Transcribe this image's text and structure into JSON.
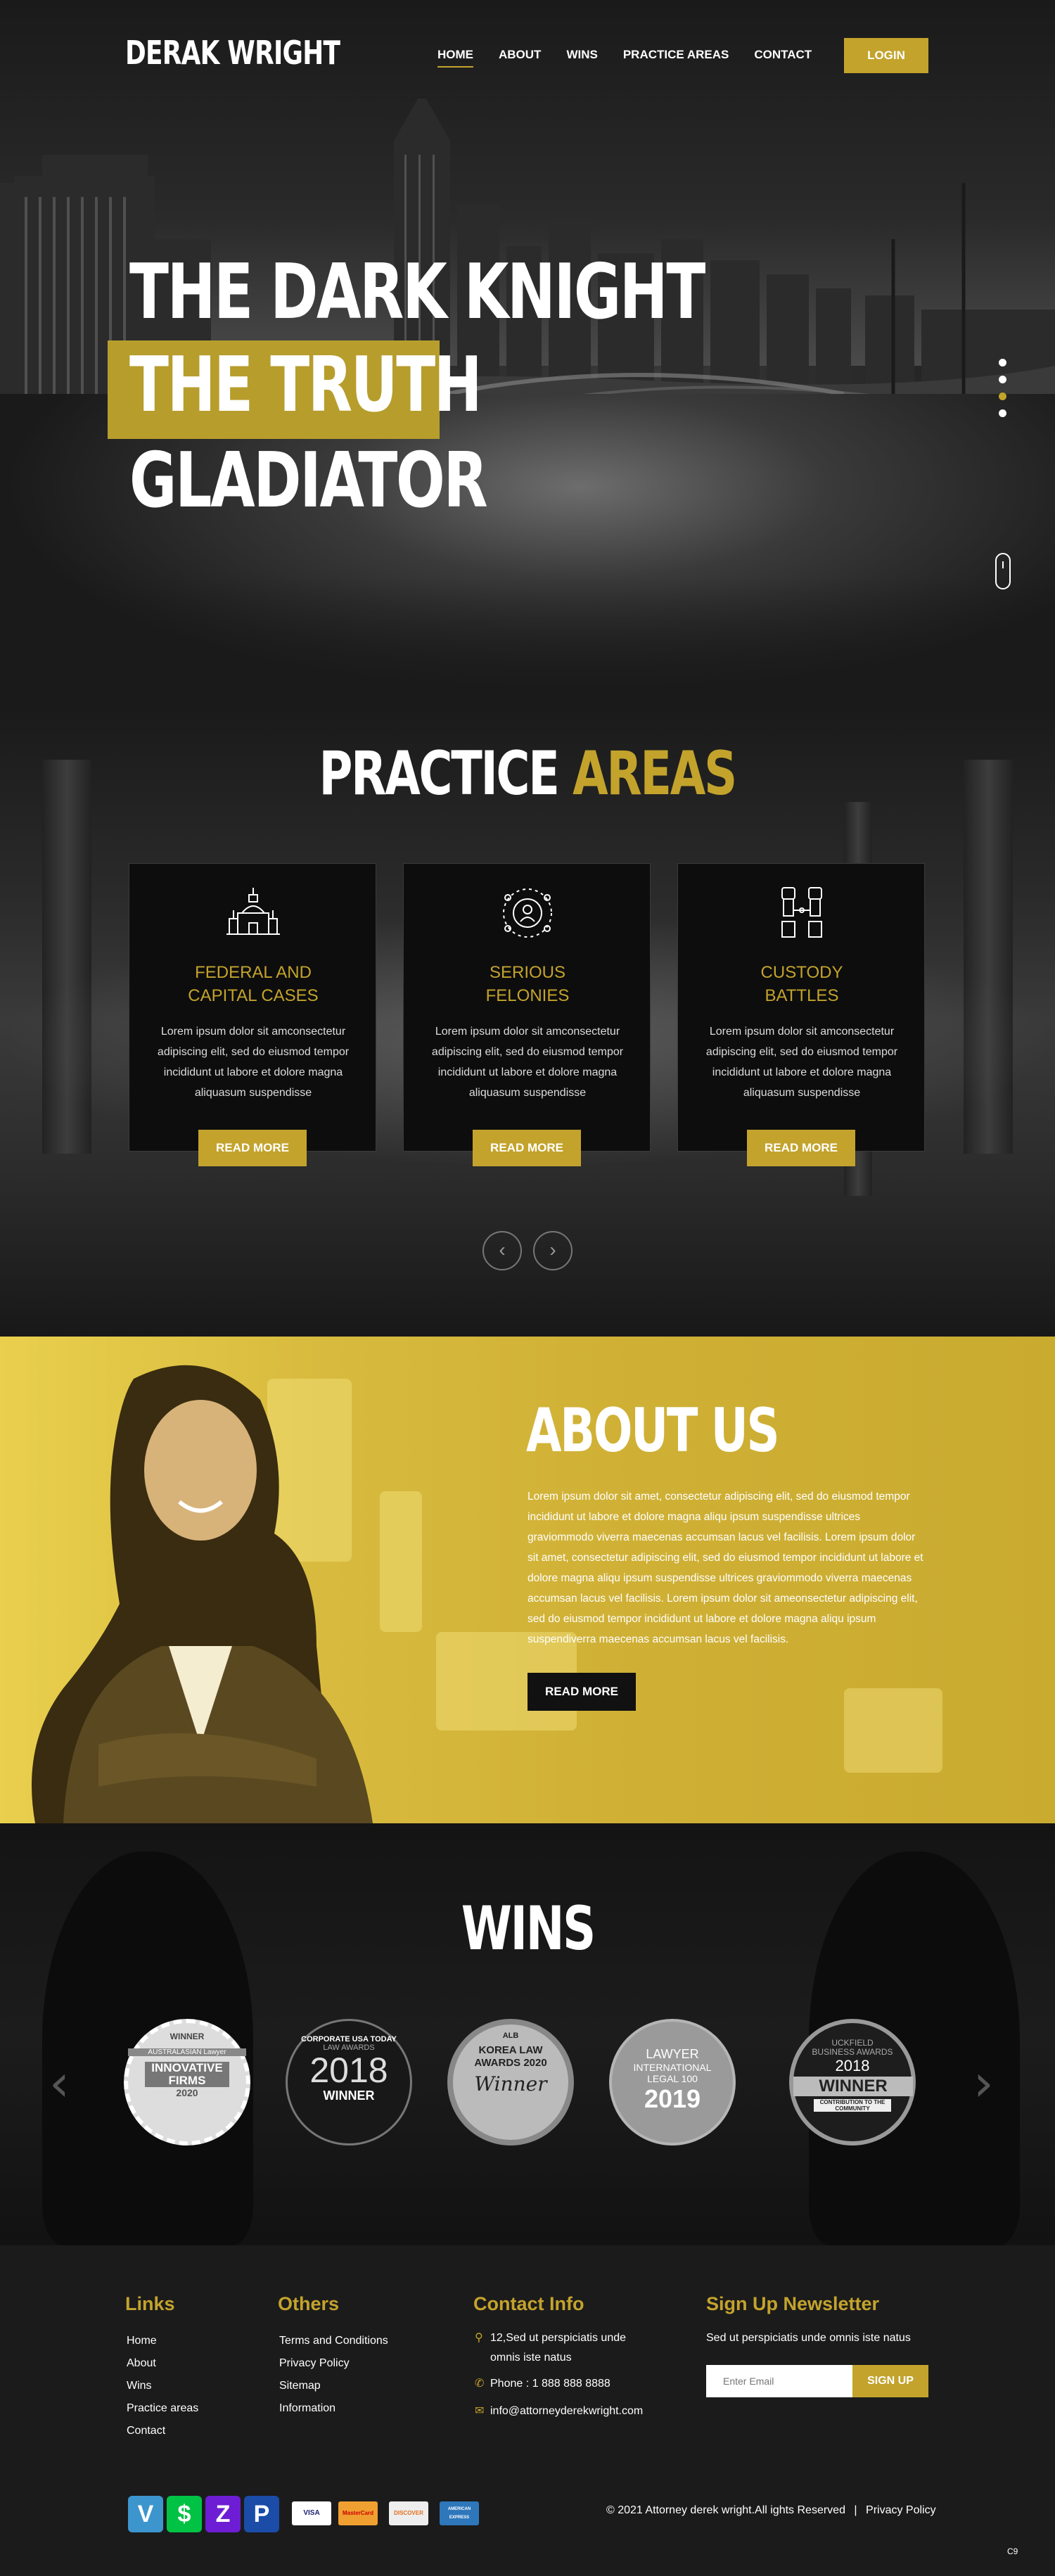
{
  "brand": {
    "name": "DERAK WRIGHT"
  },
  "nav": {
    "items": [
      {
        "label": "HOME",
        "active": true
      },
      {
        "label": "ABOUT",
        "active": false
      },
      {
        "label": "WINS",
        "active": false
      },
      {
        "label": "PRACTICE AREAS",
        "active": false
      },
      {
        "label": "CONTACT",
        "active": false
      }
    ],
    "login_label": "LOGIN"
  },
  "hero": {
    "line1": "THE DARK KNIGHT",
    "line2": "THE TRUTH",
    "line3": "GLADIATOR",
    "slides": 4,
    "active_slide": 3
  },
  "practice": {
    "title_white": "PRACTICE",
    "title_gold": "AREAS",
    "cards": [
      {
        "title_line1": "FEDERAL AND",
        "title_line2": "CAPITAL CASES",
        "icon": "building-icon",
        "text": "Lorem ipsum dolor sit amconsectetur adipiscing elit, sed do eiusmod tempor incididunt ut labore et dolore magna aliquasum suspendisse",
        "button": "READ MORE"
      },
      {
        "title_line1": "SERIOUS",
        "title_line2": "FELONIES",
        "icon": "person-network-icon",
        "text": "Lorem ipsum dolor sit amconsectetur adipiscing elit, sed do eiusmod tempor incididunt ut labore et dolore magna aliquasum suspendisse",
        "button": "READ MORE"
      },
      {
        "title_line1": "CUSTODY",
        "title_line2": "BATTLES",
        "icon": "handcuffs-icon",
        "text": "Lorem ipsum dolor sit amconsectetur adipiscing elit, sed do eiusmod tempor incididunt ut labore et dolore magna aliquasum suspendisse",
        "button": "READ MORE"
      }
    ]
  },
  "about": {
    "title": "ABOUT US",
    "text": "Lorem ipsum dolor sit amet, consectetur adipiscing elit, sed do eiusmod tempor incididunt ut labore et dolore magna aliqu ipsum suspendisse ultrices graviommodo viverra maecenas accumsan lacus vel facilisis. Lorem ipsum dolor sit amet, consectetur adipiscing elit, sed do eiusmod tempor incididunt ut labore et dolore magna aliqu ipsum suspendisse ultrices graviommodo viverra maecenas accumsan lacus vel facilisis. Lorem ipsum dolor sit ameonsectetur adipiscing elit, sed do eiusmod tempor incididunt ut labore et dolore magna aliqu ipsum suspendiverra maecenas accumsan lacus vel facilisis.",
    "button": "READ MORE"
  },
  "wins": {
    "title": "WINS",
    "badges": [
      {
        "top": "WINNER",
        "mid": "AUSTRALASIAN Lawyer",
        "main": "INNOVATIVE FIRMS",
        "year": "2020"
      },
      {
        "top": "CORPORATE USA TODAY",
        "mid": "LAW AWARDS",
        "main": "2018",
        "year": "WINNER"
      },
      {
        "top": "ALB",
        "mid": "KOREA LAW AWARDS 2020",
        "main": "Winner",
        "year": ""
      },
      {
        "top": "LAWYER",
        "mid": "INTERNATIONAL LEGAL 100",
        "main": "2019",
        "year": ""
      },
      {
        "top": "UCKFIELD BUSINESS AWARDS",
        "mid": "2018",
        "main": "WINNER",
        "year": "CONTRIBUTION TO THE COMMUNITY"
      }
    ]
  },
  "footer": {
    "links_title": "Links",
    "links": [
      "Home",
      "About",
      "Wins",
      "Practice areas",
      "Contact"
    ],
    "others_title": "Others",
    "others": [
      "Terms and Conditions",
      "Privacy Policy",
      "Sitemap",
      "Information"
    ],
    "contact_title": "Contact Info",
    "address_line1": "12,Sed ut perspiciatis unde",
    "address_line2": "omnis iste natus",
    "phone": "Phone : 1 888 888 8888",
    "email": "info@attorneyderekwright.com",
    "newsletter_title": "Sign Up Newsletter",
    "newsletter_text": "Sed ut perspiciatis unde omnis iste natus",
    "email_placeholder": "Enter Email",
    "signup_label": "SIGN UP",
    "payments": [
      "venmo",
      "cash-app",
      "zelle",
      "paypal"
    ],
    "cards": [
      "VISA",
      "MasterCard",
      "DISCOVER",
      "AMERICAN EXPRESS"
    ],
    "copyright": "© 2021 Attorney derek wright.All ights Reserved",
    "privacy": "Privacy Policy",
    "corner_code": "C9"
  },
  "colors": {
    "accent": "#c3a32c",
    "dark": "#1b1b1b",
    "card": "#0d0d0d"
  }
}
